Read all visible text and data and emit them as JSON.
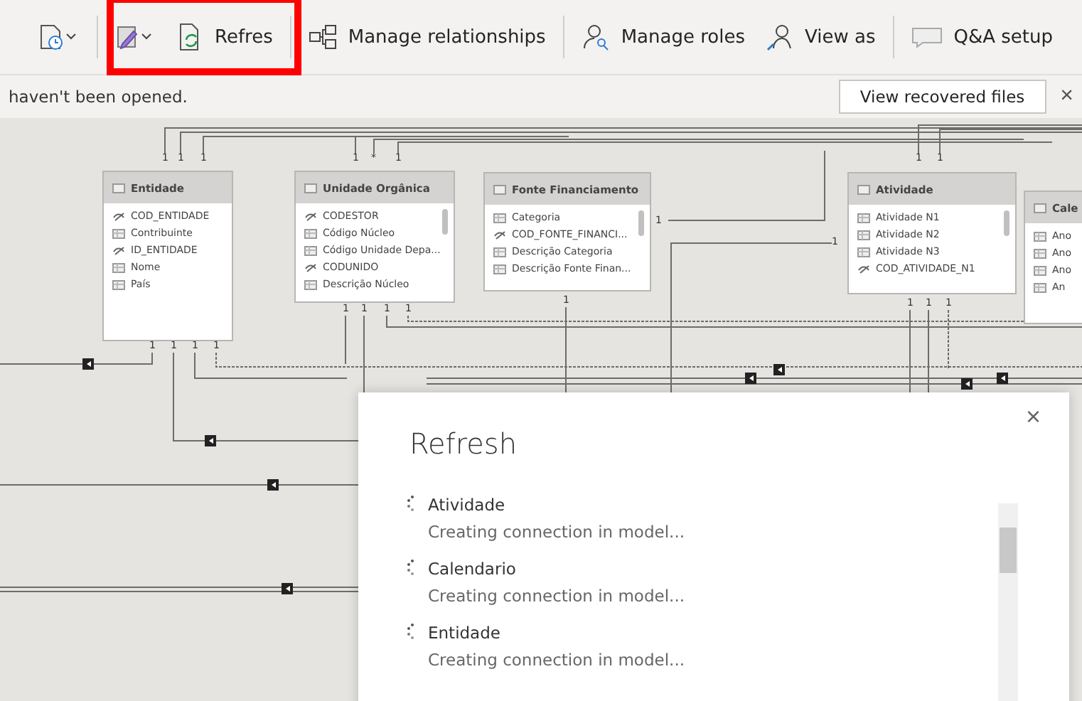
{
  "toolbar": {
    "groups": [
      {
        "highlighted": false,
        "items": [
          {
            "kind": "clock-dropdown"
          }
        ]
      },
      {
        "highlighted": true,
        "items": [
          {
            "kind": "pencil-dropdown"
          },
          {
            "kind": "refresh",
            "label": "Refres"
          }
        ]
      },
      {
        "highlighted": false,
        "items": [
          {
            "kind": "relationships",
            "label": "Manage relationships"
          }
        ]
      },
      {
        "highlighted": false,
        "items": [
          {
            "kind": "roles",
            "label": "Manage roles"
          },
          {
            "kind": "view-as",
            "label": "View as"
          }
        ]
      },
      {
        "highlighted": false,
        "items": [
          {
            "kind": "qa",
            "label": "Q&A setup"
          }
        ]
      }
    ]
  },
  "notification": {
    "message": "haven't been opened.",
    "button": "View recovered files",
    "close": "×"
  },
  "tables": [
    {
      "name": "Entidade",
      "scrollable": false,
      "fields": [
        {
          "kind": "key",
          "label": "COD_ENTIDADE"
        },
        {
          "kind": "column",
          "label": "Contribuinte"
        },
        {
          "kind": "key",
          "label": "ID_ENTIDADE"
        },
        {
          "kind": "column",
          "label": "Nome"
        },
        {
          "kind": "column",
          "label": "País"
        }
      ]
    },
    {
      "name": "Unidade Orgânica",
      "scrollable": true,
      "fields": [
        {
          "kind": "key",
          "label": "CODESTOR"
        },
        {
          "kind": "column",
          "label": "Código Núcleo"
        },
        {
          "kind": "column",
          "label": "Código Unidade Depa..."
        },
        {
          "kind": "key",
          "label": "CODUNIDO"
        },
        {
          "kind": "column",
          "label": "Descrição Núcleo"
        }
      ]
    },
    {
      "name": "Fonte Financiamento",
      "scrollable": true,
      "fields": [
        {
          "kind": "column",
          "label": "Categoria"
        },
        {
          "kind": "key",
          "label": "COD_FONTE_FINANCI..."
        },
        {
          "kind": "column",
          "label": "Descrição Categoria"
        },
        {
          "kind": "column",
          "label": "Descrição Fonte Finan..."
        }
      ]
    },
    {
      "name": "Atividade",
      "scrollable": true,
      "fields": [
        {
          "kind": "column",
          "label": "Atividade N1"
        },
        {
          "kind": "column",
          "label": "Atividade N2"
        },
        {
          "kind": "column",
          "label": "Atividade N3"
        },
        {
          "kind": "key",
          "label": "COD_ATIVIDADE_N1"
        }
      ]
    },
    {
      "name": "Cale",
      "scrollable": false,
      "fields": [
        {
          "kind": "column",
          "label": "Ano"
        },
        {
          "kind": "column",
          "label": "Ano"
        },
        {
          "kind": "column",
          "label": "Ano"
        },
        {
          "kind": "column",
          "label": "An"
        }
      ]
    }
  ],
  "cardinality_labels": [
    "1",
    "1",
    "1",
    "1",
    "*",
    "1",
    "1",
    "1",
    "1",
    "1",
    "1",
    "1",
    "1",
    "1",
    "1",
    "1",
    "1",
    "1",
    "1",
    "1",
    "1",
    "1"
  ],
  "refresh_dialog": {
    "close": "×",
    "title": "Refresh",
    "items": [
      {
        "name": "Atividade",
        "status": "Creating connection in model..."
      },
      {
        "name": "Calendario",
        "status": "Creating connection in model..."
      },
      {
        "name": "Entidade",
        "status": "Creating connection in model..."
      }
    ]
  }
}
